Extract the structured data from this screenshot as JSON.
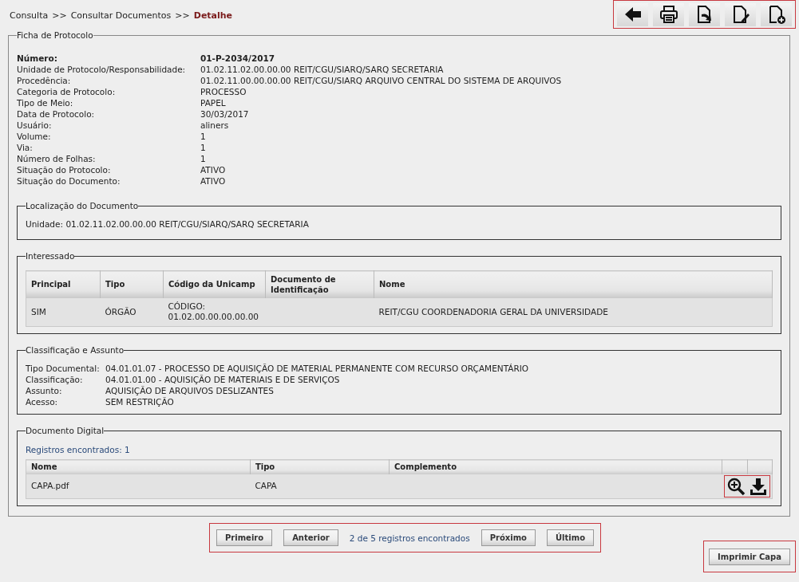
{
  "breadcrumb": [
    {
      "label": "Consulta",
      "current": false
    },
    {
      "label": "Consultar Documentos",
      "current": false
    },
    {
      "label": "Detalhe",
      "current": true
    }
  ],
  "breadcrumb_separator": ">>",
  "ficha": {
    "legend": "Ficha de Protocolo",
    "fields": [
      {
        "label": "Número:",
        "value": "01-P-2034/2017",
        "bold": true
      },
      {
        "label": "Unidade de Protocolo/Responsabilidade:",
        "value": "01.02.11.02.00.00.00 REIT/CGU/SIARQ/SARQ SECRETARIA",
        "bold": false
      },
      {
        "label": "Procedência:",
        "value": "01.02.11.00.00.00.00 REIT/CGU/SIARQ ARQUIVO CENTRAL DO SISTEMA DE ARQUIVOS",
        "bold": false
      },
      {
        "label": "Categoria de Protocolo:",
        "value": "PROCESSO",
        "bold": false
      },
      {
        "label": "Tipo de Meio:",
        "value": "PAPEL",
        "bold": false
      },
      {
        "label": "Data de Protocolo:",
        "value": "30/03/2017",
        "bold": false
      },
      {
        "label": "Usuário:",
        "value": "aliners",
        "bold": false
      },
      {
        "label": "Volume:",
        "value": "1",
        "bold": false
      },
      {
        "label": "Via:",
        "value": "1",
        "bold": false
      },
      {
        "label": "Número de Folhas:",
        "value": "1",
        "bold": false
      },
      {
        "label": "Situação do Protocolo:",
        "value": "ATIVO",
        "bold": false
      },
      {
        "label": "Situação do Documento:",
        "value": "ATIVO",
        "bold": false
      }
    ]
  },
  "localizacao": {
    "legend": "Localização do Documento",
    "label": "Unidade:",
    "value": "01.02.11.02.00.00.00 REIT/CGU/SIARQ/SARQ SECRETARIA"
  },
  "interessado": {
    "legend": "Interessado",
    "columns": [
      "Principal",
      "Tipo",
      "Código da Unicamp",
      "Documento de Identificação",
      "Nome"
    ],
    "rows": [
      {
        "cells": [
          "SIM",
          "ÓRGÃO",
          "CÓDIGO: 01.02.00.00.00.00.00",
          "",
          "REIT/CGU COORDENADORIA GERAL DA UNIVERSIDADE"
        ]
      }
    ]
  },
  "classificacao": {
    "legend": "Classificação e Assunto",
    "fields": [
      {
        "label": "Tipo Documental:",
        "value": "04.01.01.07 - PROCESSO DE AQUISIÇÃO DE MATERIAL PERMANENTE COM RECURSO ORÇAMENTÁRIO"
      },
      {
        "label": "Classificação:",
        "value": "04.01.01.00 - AQUISIÇÃO DE MATERIAIS E DE SERVIÇOS"
      },
      {
        "label": "Assunto:",
        "value": "AQUISIÇÃO DE ARQUIVOS DESLIZANTES"
      },
      {
        "label": "Acesso:",
        "value": "SEM RESTRIÇÃO"
      }
    ]
  },
  "documento_digital": {
    "legend": "Documento Digital",
    "count": "Registros encontrados: 1",
    "columns": [
      "Nome",
      "Tipo",
      "Complemento"
    ],
    "rows": [
      {
        "nome": "CAPA.pdf",
        "tipo": "CAPA"
      }
    ]
  },
  "pager": {
    "before": [
      "Primeiro",
      "Anterior"
    ],
    "status": "2 de 5 registros encontrados",
    "after": [
      "Próximo",
      "Último"
    ]
  },
  "print_button": "Imprimir Capa"
}
